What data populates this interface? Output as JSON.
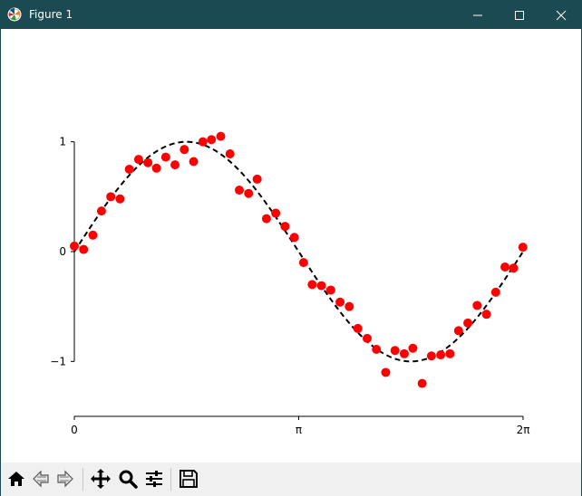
{
  "window": {
    "title": "Figure 1",
    "title_bar_color": "#1b4a52",
    "app_icon": "matplotlib-logo-icon",
    "controls": {
      "minimize": "minimize-icon",
      "maximize": "maximize-icon",
      "close": "close-icon"
    }
  },
  "toolbar": {
    "background": "#f0f0f0",
    "buttons": [
      {
        "name": "home-button",
        "icon": "home-icon"
      },
      {
        "name": "back-button",
        "icon": "back-arrow-icon"
      },
      {
        "name": "forward-button",
        "icon": "forward-arrow-icon"
      },
      {
        "name": "pan-button",
        "icon": "move-icon"
      },
      {
        "name": "zoom-button",
        "icon": "magnifier-icon"
      },
      {
        "name": "configure-subplots-button",
        "icon": "sliders-icon"
      },
      {
        "name": "save-button",
        "icon": "floppy-disk-icon"
      }
    ]
  },
  "chart_data": {
    "type": "scatter",
    "xlim": [
      0,
      6.2832
    ],
    "ylim": [
      -1.5,
      1.5
    ],
    "x_ticks": [
      {
        "value": 0,
        "label": "0"
      },
      {
        "value": 3.1416,
        "label": "π"
      },
      {
        "value": 6.2832,
        "label": "2π"
      }
    ],
    "y_ticks": [
      {
        "value": 1,
        "label": "1"
      },
      {
        "value": 0,
        "label": "0"
      },
      {
        "value": -1,
        "label": "−1"
      }
    ],
    "spines": {
      "left": true,
      "bottom": true,
      "top": false,
      "right": false
    },
    "series": [
      {
        "kind": "line",
        "style": "dashed",
        "color": "#000000",
        "function": "sin(x)",
        "x_range": [
          0,
          6.2832
        ]
      },
      {
        "kind": "scatter",
        "color": "#ff0000",
        "points": [
          [
            0.0,
            0.05
          ],
          [
            0.13,
            0.02
          ],
          [
            0.26,
            0.15
          ],
          [
            0.38,
            0.37
          ],
          [
            0.51,
            0.5
          ],
          [
            0.64,
            0.48
          ],
          [
            0.77,
            0.75
          ],
          [
            0.9,
            0.84
          ],
          [
            1.03,
            0.81
          ],
          [
            1.15,
            0.76
          ],
          [
            1.28,
            0.86
          ],
          [
            1.41,
            0.79
          ],
          [
            1.54,
            0.93
          ],
          [
            1.67,
            0.82
          ],
          [
            1.8,
            1.0
          ],
          [
            1.92,
            1.02
          ],
          [
            2.05,
            1.05
          ],
          [
            2.18,
            0.89
          ],
          [
            2.31,
            0.56
          ],
          [
            2.44,
            0.53
          ],
          [
            2.56,
            0.66
          ],
          [
            2.69,
            0.3
          ],
          [
            2.82,
            0.35
          ],
          [
            2.95,
            0.23
          ],
          [
            3.08,
            0.13
          ],
          [
            3.21,
            -0.1
          ],
          [
            3.33,
            -0.3
          ],
          [
            3.46,
            -0.31
          ],
          [
            3.59,
            -0.35
          ],
          [
            3.72,
            -0.46
          ],
          [
            3.85,
            -0.5
          ],
          [
            3.97,
            -0.7
          ],
          [
            4.1,
            -0.79
          ],
          [
            4.23,
            -0.89
          ],
          [
            4.36,
            -1.1
          ],
          [
            4.49,
            -0.9
          ],
          [
            4.62,
            -0.93
          ],
          [
            4.74,
            -0.88
          ],
          [
            4.87,
            -1.2
          ],
          [
            5.0,
            -0.95
          ],
          [
            5.13,
            -0.94
          ],
          [
            5.26,
            -0.93
          ],
          [
            5.38,
            -0.72
          ],
          [
            5.51,
            -0.65
          ],
          [
            5.64,
            -0.49
          ],
          [
            5.77,
            -0.57
          ],
          [
            5.9,
            -0.37
          ],
          [
            6.03,
            -0.14
          ],
          [
            6.15,
            -0.15
          ],
          [
            6.28,
            0.04
          ]
        ]
      }
    ]
  }
}
